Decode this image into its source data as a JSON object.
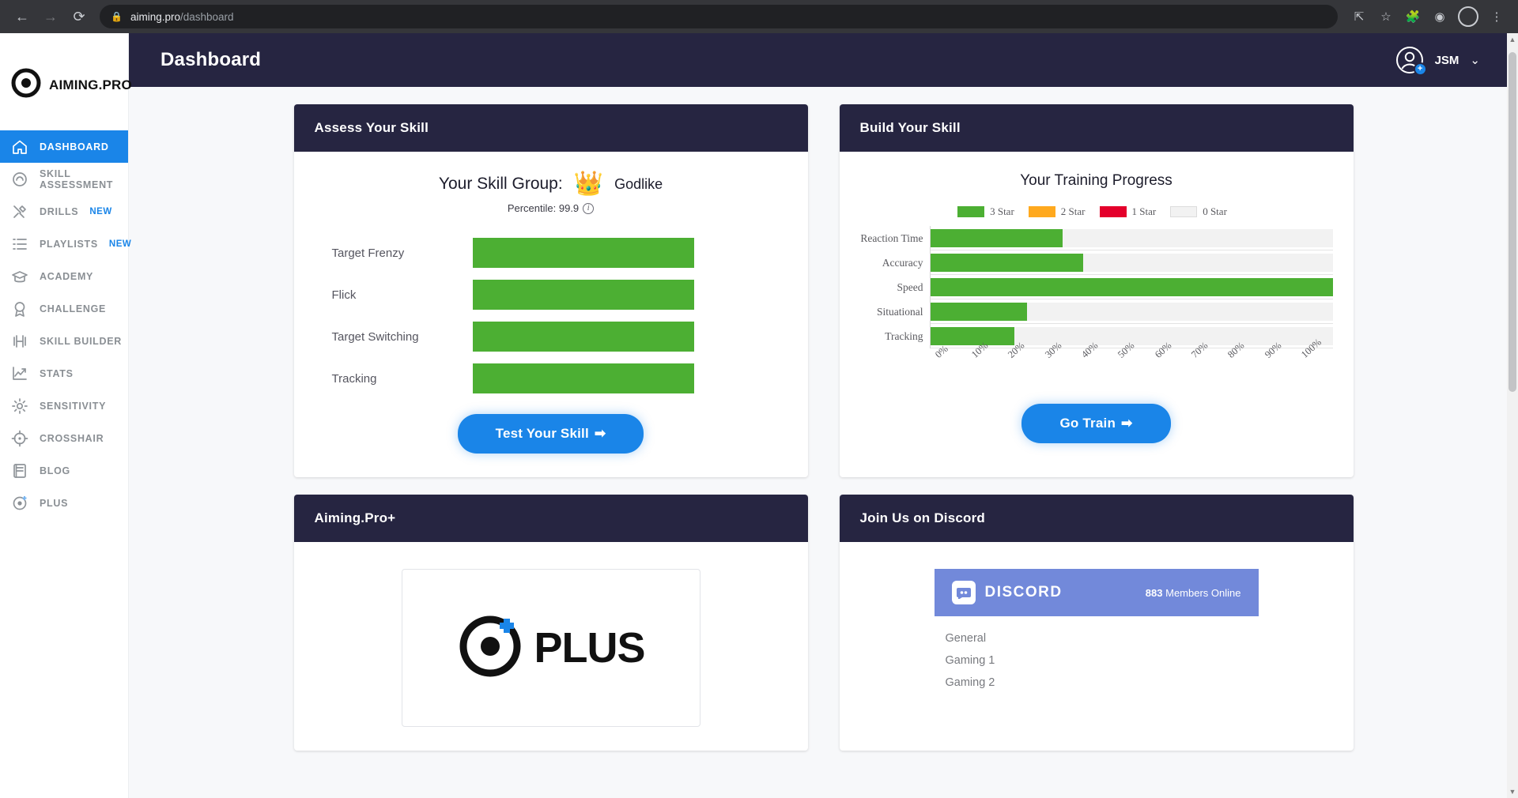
{
  "browser": {
    "back_icon": "back-arrow-icon",
    "forward_icon": "forward-arrow-icon",
    "reload_icon": "reload-icon",
    "lock_icon": "lock-icon",
    "url_domain": "aiming.pro",
    "url_path": "/dashboard",
    "share_icon": "share-icon",
    "bookmark_icon": "star-icon",
    "extension_icon": "extensions-icon",
    "profile_icon": "profile-avatar-icon",
    "menu_icon": "kebab-menu-icon"
  },
  "brand": {
    "name": "AIMING.PRO",
    "logo_icon": "target-dot-logo-icon"
  },
  "sidebar": {
    "items": [
      {
        "label": "DASHBOARD",
        "icon": "home-icon",
        "active": true,
        "badge": ""
      },
      {
        "label": "SKILL ASSESSMENT",
        "icon": "gauge-icon",
        "active": false,
        "badge": ""
      },
      {
        "label": "DRILLS",
        "icon": "tools-icon",
        "active": false,
        "badge": "NEW"
      },
      {
        "label": "PLAYLISTS",
        "icon": "list-icon",
        "active": false,
        "badge": "NEW"
      },
      {
        "label": "ACADEMY",
        "icon": "graduation-cap-icon",
        "active": false,
        "badge": ""
      },
      {
        "label": "CHALLENGE",
        "icon": "award-ribbon-icon",
        "active": false,
        "badge": ""
      },
      {
        "label": "SKILL BUILDER",
        "icon": "dumbbell-icon",
        "active": false,
        "badge": ""
      },
      {
        "label": "STATS",
        "icon": "chart-line-icon",
        "active": false,
        "badge": ""
      },
      {
        "label": "SENSITIVITY",
        "icon": "gear-icon",
        "active": false,
        "badge": ""
      },
      {
        "label": "CROSSHAIR",
        "icon": "crosshair-icon",
        "active": false,
        "badge": ""
      },
      {
        "label": "BLOG",
        "icon": "book-icon",
        "active": false,
        "badge": ""
      },
      {
        "label": "PLUS",
        "icon": "plus-target-icon",
        "active": false,
        "badge": ""
      }
    ]
  },
  "header": {
    "title": "Dashboard",
    "user_name": "JSM",
    "chevron": "⌄",
    "avatar_icon": "user-avatar-icon",
    "avatar_badge": "+"
  },
  "assess_card": {
    "title": "Assess Your Skill",
    "skill_group_label": "Your Skill Group:",
    "crown_icon": "crown-icon",
    "rank": "Godlike",
    "percentile_label": "Percentile: 99.9",
    "info_icon": "info-icon",
    "skills": [
      {
        "label": "Target Frenzy",
        "value": 100
      },
      {
        "label": "Flick",
        "value": 100
      },
      {
        "label": "Target Switching",
        "value": 100
      },
      {
        "label": "Tracking",
        "value": 100
      }
    ],
    "cta_label": "Test Your Skill",
    "cta_arrow": "➡"
  },
  "build_card": {
    "title": "Build Your Skill",
    "cta_label": "Go Train",
    "cta_arrow": "➡"
  },
  "chart_data": {
    "type": "bar",
    "orientation": "horizontal",
    "title": "Your Training Progress",
    "categories": [
      "Reaction Time",
      "Accuracy",
      "Speed",
      "Situational",
      "Tracking"
    ],
    "values": [
      33,
      38,
      100,
      24,
      21
    ],
    "series": [
      {
        "name": "3 Star",
        "values": [
          33,
          38,
          100,
          24,
          21
        ]
      }
    ],
    "legend": [
      {
        "label": "3 Star",
        "color": "#4caf33"
      },
      {
        "label": "2 Star",
        "color": "#ffa91e"
      },
      {
        "label": "1 Star",
        "color": "#e4002b"
      },
      {
        "label": "0 Star",
        "color": "#f2f2f2"
      }
    ],
    "legend_position": "top",
    "xlabel": "",
    "ylabel": "",
    "xlim": [
      0,
      100
    ],
    "xticks": [
      "0%",
      "10%",
      "20%",
      "30%",
      "40%",
      "50%",
      "60%",
      "70%",
      "80%",
      "90%",
      "100%"
    ],
    "grid": true
  },
  "plus_card": {
    "title": "Aiming.Pro+",
    "logo_icon": "aiming-pro-plus-logo-icon",
    "logo_text": "PLUS"
  },
  "discord_card": {
    "title": "Join Us on Discord",
    "logo_icon": "discord-logo-icon",
    "wordmark": "DISCORD",
    "members_count": "883",
    "members_label": "Members Online",
    "channels": [
      "General",
      "Gaming 1",
      "Gaming 2"
    ]
  },
  "colors": {
    "accent_blue": "#1a85e8",
    "header_navy": "#262541",
    "bar_green": "#4caf33",
    "discord_purple": "#7289da"
  }
}
